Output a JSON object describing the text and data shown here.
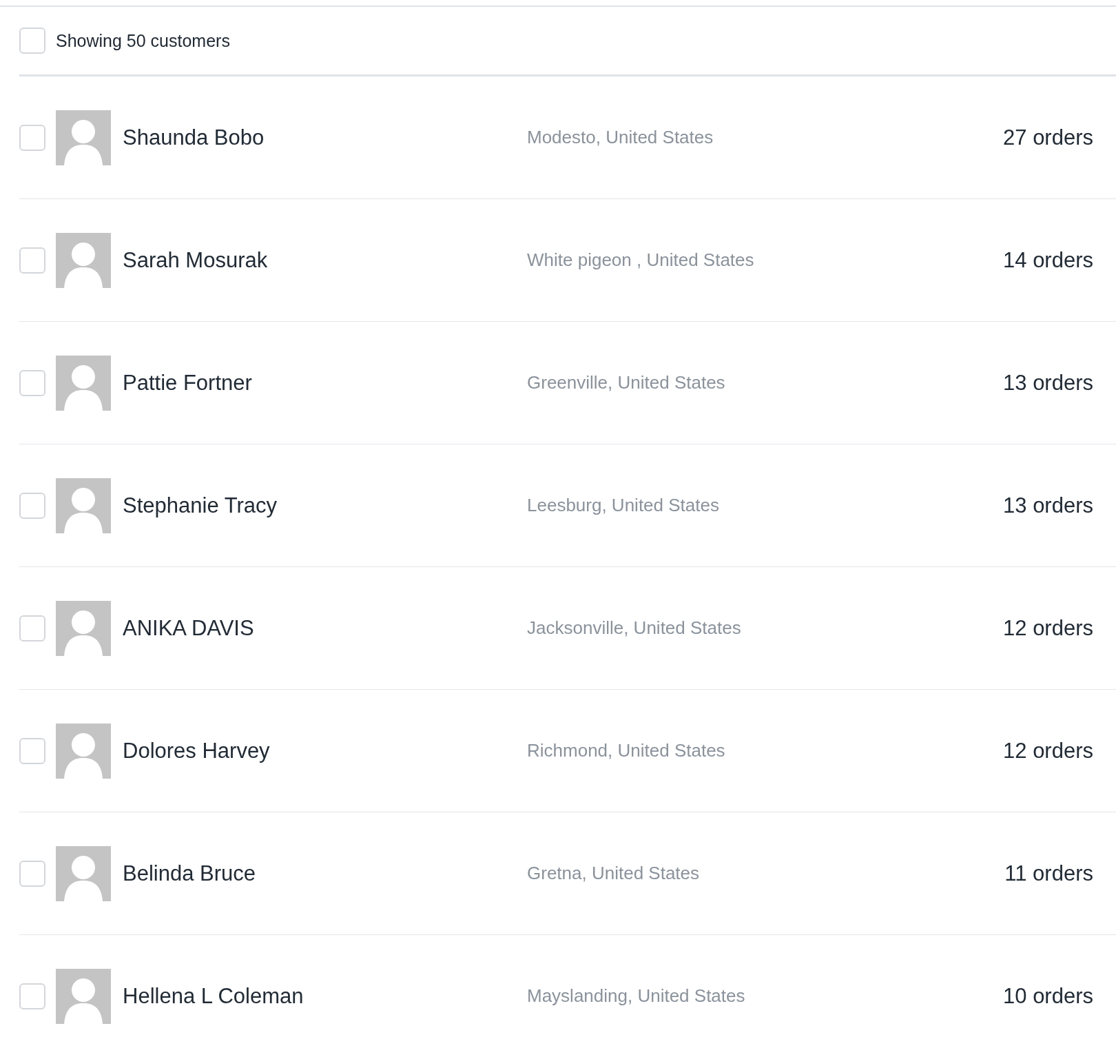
{
  "header": {
    "checked": false,
    "label": "Showing 50 customers"
  },
  "customers": [
    {
      "checked": false,
      "name": "Shaunda Bobo",
      "location": "Modesto, United States",
      "orders": "27 orders"
    },
    {
      "checked": false,
      "name": "Sarah Mosurak",
      "location": "White pigeon , United States",
      "orders": "14 orders"
    },
    {
      "checked": false,
      "name": "Pattie Fortner",
      "location": "Greenville, United States",
      "orders": "13 orders"
    },
    {
      "checked": false,
      "name": "Stephanie Tracy",
      "location": "Leesburg, United States",
      "orders": "13 orders"
    },
    {
      "checked": false,
      "name": "ANIKA DAVIS",
      "location": "Jacksonville, United States",
      "orders": "12 orders"
    },
    {
      "checked": false,
      "name": "Dolores Harvey",
      "location": "Richmond, United States",
      "orders": "12 orders"
    },
    {
      "checked": false,
      "name": "Belinda Bruce",
      "location": "Gretna, United States",
      "orders": "11 orders"
    },
    {
      "checked": false,
      "name": "Hellena L Coleman",
      "location": "Mayslanding, United States",
      "orders": "10 orders"
    }
  ]
}
